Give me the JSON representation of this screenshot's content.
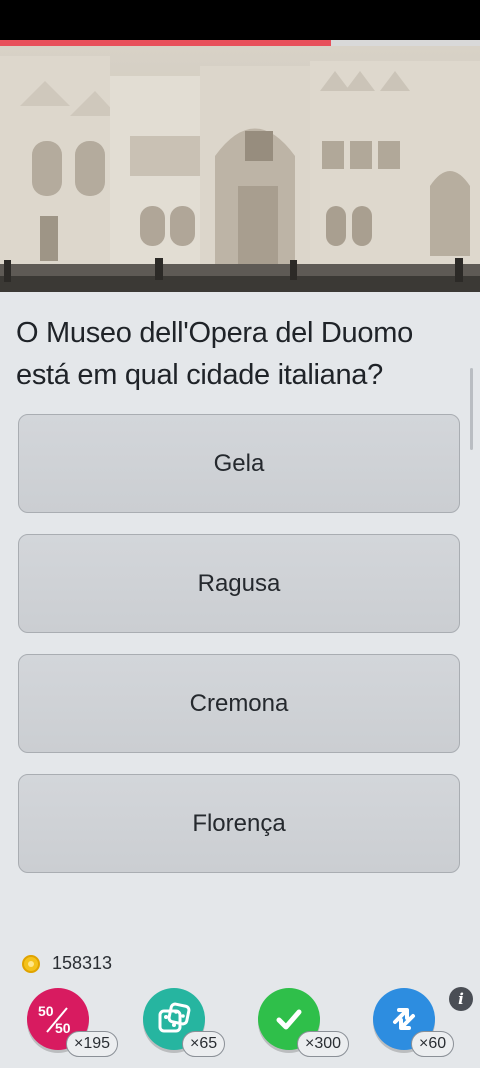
{
  "quiz": {
    "progress": 0.69,
    "question": "O Museo dell'Opera del Duomo está em qual cidade italiana?",
    "answers": [
      "Gela",
      "Ragusa",
      "Cremona",
      "Florença"
    ]
  },
  "wallet": {
    "coins": "158313"
  },
  "powerups": {
    "fifty_fifty": {
      "label": "50",
      "label2": "50",
      "count": "×195",
      "color": "#d81b60"
    },
    "dice": {
      "count": "×65",
      "color": "#26b5a0"
    },
    "correct": {
      "count": "×300",
      "color": "#2fbf4a"
    },
    "swap": {
      "count": "×60",
      "color": "#2d8de0"
    }
  },
  "info": {
    "label": "i"
  },
  "image": {
    "subject": "museum-hall-with-marble-facade-and-statues"
  }
}
